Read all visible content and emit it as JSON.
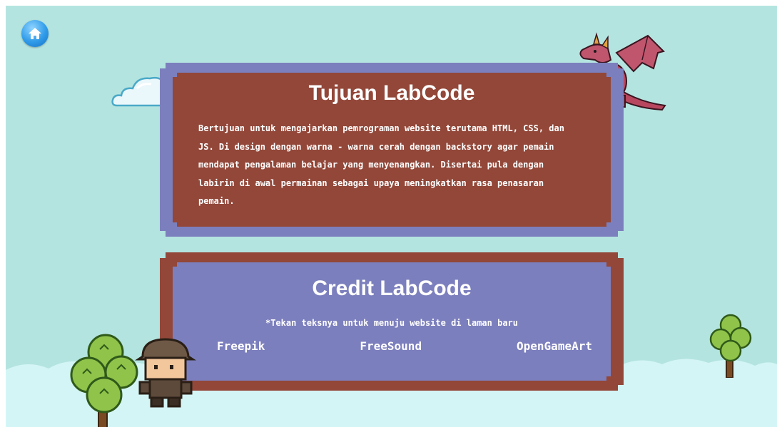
{
  "tujuan": {
    "title": "Tujuan LabCode",
    "lines": [
      "Bertujuan untuk mengajarkan pemrograman website terutama HTML, CSS, dan",
      "JS. Di design dengan warna - warna cerah dengan backstory agar pemain",
      "mendapat pengalaman belajar yang menyenangkan. Disertai pula dengan",
      "labirin di awal permainan sebagai upaya meningkatkan rasa penasaran",
      "pemain."
    ]
  },
  "credit": {
    "title": "Credit LabCode",
    "note": "*Tekan teksnya untuk menuju website di laman baru",
    "links": [
      "Freepik",
      "FreeSound",
      "OpenGameArt"
    ]
  },
  "icons": {
    "home": "home-icon"
  },
  "colors": {
    "background": "#b4e4e0",
    "ground": "#d4f5f5",
    "panel_brown": "#924739",
    "panel_purple": "#7c7fbd",
    "text": "#ffffff",
    "home_button": "#2f9be9"
  }
}
